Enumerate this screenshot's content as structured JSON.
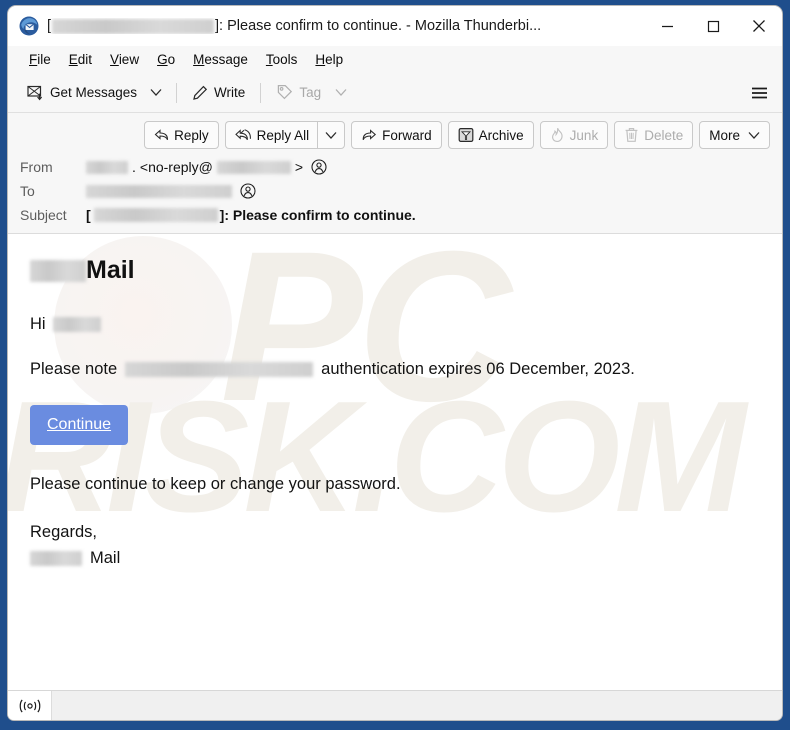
{
  "window": {
    "title_prefix": "[",
    "title_redacted": "REDACTED",
    "title_suffix": "]: Please confirm to continue. - Mozilla Thunderbi...",
    "controls": {
      "minimize": "—",
      "maximize": "□",
      "close": "✕"
    }
  },
  "menubar": {
    "items": [
      {
        "label": "File",
        "accel": "F"
      },
      {
        "label": "Edit",
        "accel": "E"
      },
      {
        "label": "View",
        "accel": "V"
      },
      {
        "label": "Go",
        "accel": "G"
      },
      {
        "label": "Message",
        "accel": "M"
      },
      {
        "label": "Tools",
        "accel": "T"
      },
      {
        "label": "Help",
        "accel": "H"
      }
    ]
  },
  "toolbar": {
    "get_messages": "Get Messages",
    "get_messages_caret": "∨",
    "write": "Write",
    "tag": "Tag",
    "tag_caret": "∨",
    "app_menu": "app-menu"
  },
  "message_toolbar": {
    "reply": "Reply",
    "reply_all": "Reply All",
    "reply_all_caret": "∨",
    "forward": "Forward",
    "archive": "Archive",
    "junk": "Junk",
    "delete": "Delete",
    "more": "More",
    "more_caret": "∨"
  },
  "headers": {
    "from_label": "From",
    "from_name_redacted": "REDACT",
    "from_dot": ".",
    "from_open": "<no-reply@",
    "from_domain_redacted": "REDACTED",
    "from_close": ">",
    "to_label": "To",
    "to_redacted": "REDACTED-RECIPIENT",
    "subject_label": "Subject",
    "subject_open": "[",
    "subject_redacted": "REDACTED",
    "subject_text": "]: Please confirm to continue."
  },
  "body": {
    "brand_redacted": "REDACT",
    "brand_text": "Mail",
    "greeting": "Hi",
    "greeting_name_redacted": "REDACTED",
    "note_prefix": "Please note",
    "note_redacted": "REDACTED-ACCOUNT",
    "note_suffix": "authentication expires 06 December, 2023.",
    "cta_label": "Continue",
    "instruction": "Please continue to keep or change your password.",
    "regards": "Regards,",
    "signature_redacted": "REDACT",
    "signature_text": "Mail",
    "watermark_top": "PC",
    "watermark_bottom": "RISK.COM"
  },
  "statusbar": {
    "connection_icon": "((o))"
  },
  "colors": {
    "desktop_background": "#1f4e8c",
    "window_background": "#f7f7f7",
    "body_background": "#ffffff",
    "cta_blue": "#6a8ce0",
    "watermark": "#f2efe9",
    "disabled_text": "#a8a8a8"
  }
}
